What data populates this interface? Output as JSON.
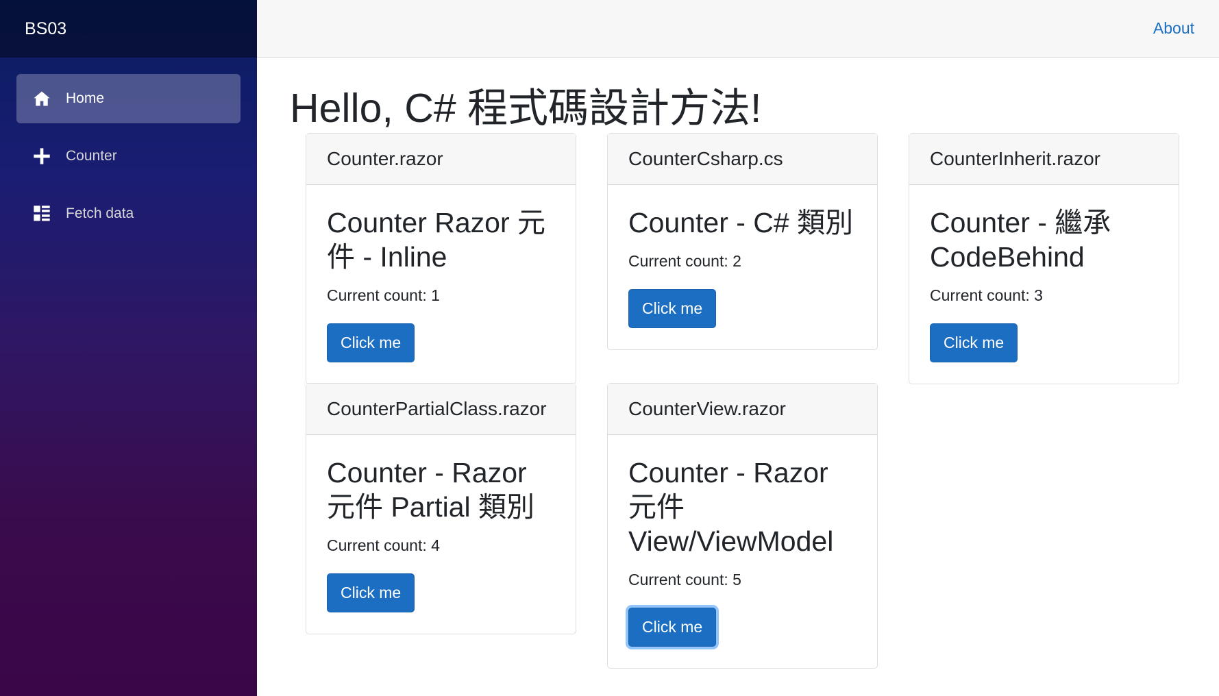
{
  "app": {
    "brand": "BS03"
  },
  "nav": {
    "items": [
      {
        "label": "Home",
        "icon": "home-icon",
        "active": true
      },
      {
        "label": "Counter",
        "icon": "plus-icon",
        "active": false
      },
      {
        "label": "Fetch data",
        "icon": "list-rich-icon",
        "active": false
      }
    ]
  },
  "topbar": {
    "about_label": "About"
  },
  "page": {
    "title": "Hello, C# 程式碼設計方法!"
  },
  "cards": [
    {
      "header": "Counter.razor",
      "title": "Counter Razor 元件 - Inline",
      "count_text": "Current count: 1",
      "button_label": "Click me"
    },
    {
      "header": "CounterCsharp.cs",
      "title": "Counter - C# 類別",
      "count_text": "Current count: 2",
      "button_label": "Click me"
    },
    {
      "header": "CounterInherit.razor",
      "title": "Counter - 繼承 CodeBehind",
      "count_text": "Current count: 3",
      "button_label": "Click me"
    },
    {
      "header": "CounterPartialClass.razor",
      "title": "Counter - Razor 元件 Partial 類別",
      "count_text": "Current count: 4",
      "button_label": "Click me"
    },
    {
      "header": "CounterView.razor",
      "title": "Counter - Razor 元件 View/ViewModel",
      "count_text": "Current count: 5",
      "button_label": "Click me"
    }
  ],
  "colors": {
    "accent": "#1b6ec2",
    "sidebar_top": "#081d5e",
    "sidebar_bottom": "#3a0647",
    "topbar_bg": "#f7f7f7"
  }
}
